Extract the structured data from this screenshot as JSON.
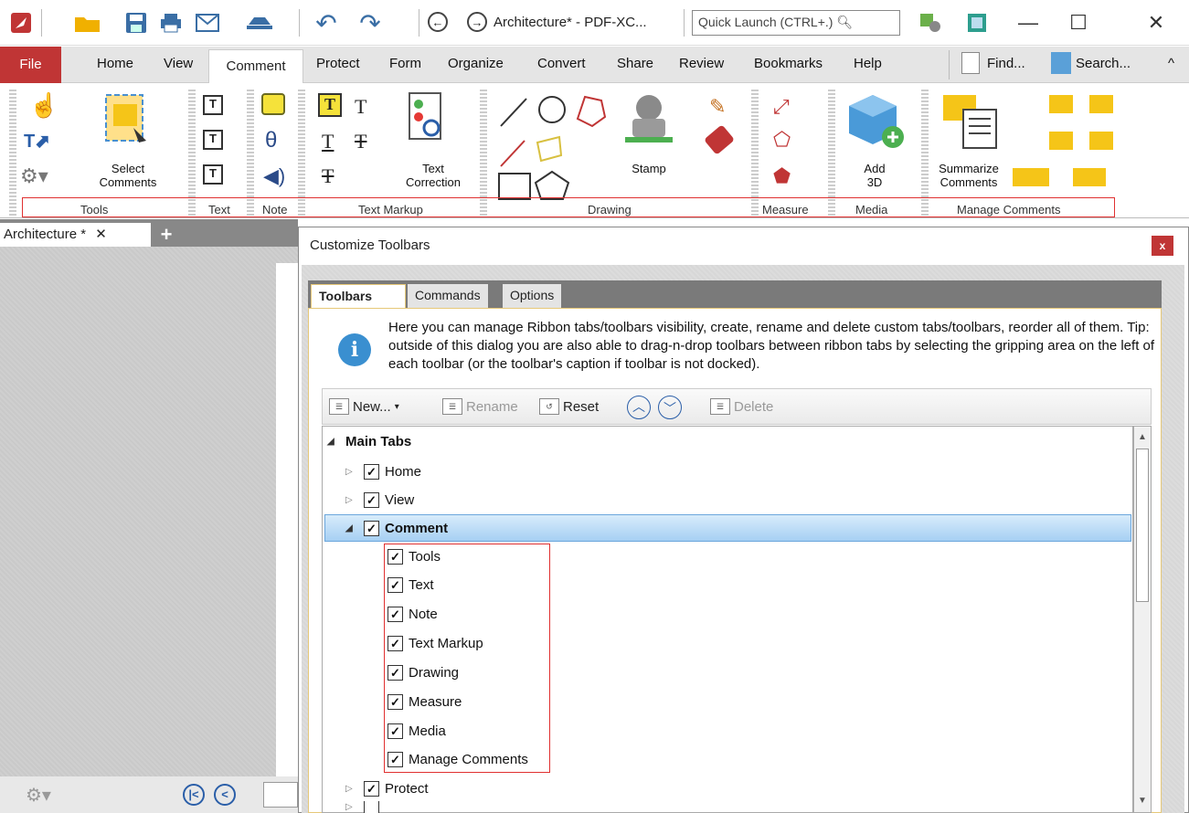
{
  "window": {
    "doc_title": "Architecture* - PDF-XC...",
    "quick_launch": "Quick Launch (CTRL+.)",
    "minimize": "—",
    "maximize": "☐",
    "close": "✕"
  },
  "menu": {
    "file": "File",
    "tabs": [
      "Home",
      "View",
      "Comment",
      "Protect",
      "Form",
      "Organize",
      "Convert",
      "Share",
      "Review",
      "Bookmarks",
      "Help"
    ],
    "find": "Find...",
    "search": "Search...",
    "collapse": "^"
  },
  "ribbon": {
    "select_comments": "Select\nComments",
    "text_correction": "Text\nCorrection",
    "stamp": "Stamp",
    "add_3d": "Add\n3D",
    "summarize_comments": "Summarize\nComments",
    "groups": [
      "Tools",
      "Text",
      "Note",
      "Text Markup",
      "Drawing",
      "Measure",
      "Media",
      "Manage Comments"
    ]
  },
  "doc": {
    "tab": "Architecture *",
    "close": "✕",
    "add": "+"
  },
  "dialog": {
    "title": "Customize Toolbars",
    "close": "x",
    "tabs": [
      "Toolbars",
      "Commands",
      "Options"
    ],
    "info": "Here you can manage Ribbon tabs/toolbars visibility, create, rename and delete custom tabs/toolbars, reorder all of them. Tip: outside of this dialog you are also able to drag-n-drop toolbars between ribbon tabs by selecting the gripping area on the left of each toolbar (or the toolbar's caption if toolbar is not docked).",
    "toolbar": {
      "new": "New...",
      "rename": "Rename",
      "reset": "Reset",
      "delete": "Delete"
    },
    "tree": {
      "root": "Main Tabs",
      "items": [
        "Home",
        "View",
        "Comment",
        "Tools",
        "Text",
        "Note",
        "Text Markup",
        "Drawing",
        "Measure",
        "Media",
        "Manage Comments",
        "Protect"
      ]
    }
  },
  "colors": {
    "accent_red": "#c03535",
    "selection": "#a6d0f3",
    "highlight_box": "#e03030"
  }
}
